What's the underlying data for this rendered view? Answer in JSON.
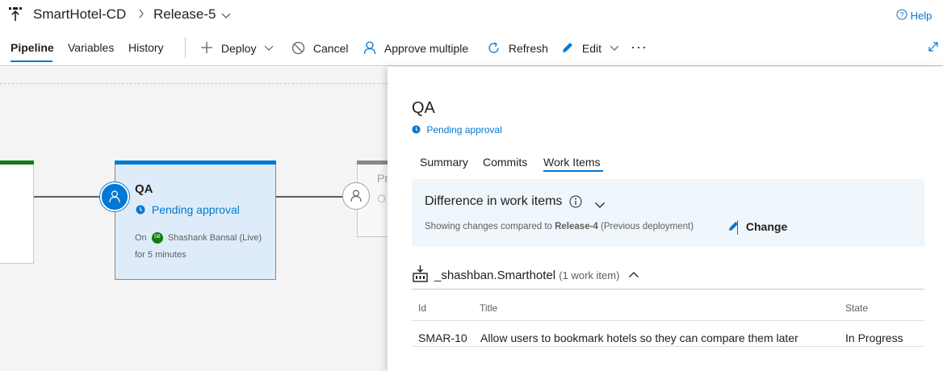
{
  "header": {
    "pipeline_name": "SmartHotel-CD",
    "release_name": "Release-5",
    "help_label": "Help"
  },
  "tabs": [
    "Pipeline",
    "Variables",
    "History"
  ],
  "toolbar": {
    "deploy": "Deploy",
    "cancel": "Cancel",
    "approve_multiple": "Approve multiple",
    "refresh": "Refresh",
    "edit": "Edit",
    "more": "···"
  },
  "canvas": {
    "qa_stage": {
      "name": "QA",
      "status": "Pending approval",
      "on_label": "On",
      "agent_initials": "SB",
      "agent": "Shashank Bansal (Live)",
      "duration": "for 5 minutes"
    },
    "next_stage": {
      "name_fragment": "Pr",
      "status_fragment": "O"
    }
  },
  "panel": {
    "title": "QA",
    "status": "Pending approval",
    "subtabs": [
      "Summary",
      "Commits",
      "Work Items"
    ],
    "active_subtab": "Work Items",
    "diff_title": "Difference in work items",
    "showing_prefix": "Showing changes compared to",
    "compare_release": "Release-4",
    "compare_suffix": "(Previous deployment)",
    "change_label": "Change",
    "artifact_name": "_shashban.Smarthotel",
    "artifact_count": "(1 work item)",
    "table": {
      "headers": {
        "id": "Id",
        "title": "Title",
        "state": "State"
      },
      "rows": [
        {
          "id": "SMAR-10",
          "title": "Allow users to bookmark hotels so they can compare them later",
          "state": "In Progress"
        }
      ]
    }
  },
  "colors": {
    "accent": "#0078d4",
    "success": "#107c10",
    "canvas_bg": "#f4f4f4",
    "panel_box": "#eff6fc"
  }
}
